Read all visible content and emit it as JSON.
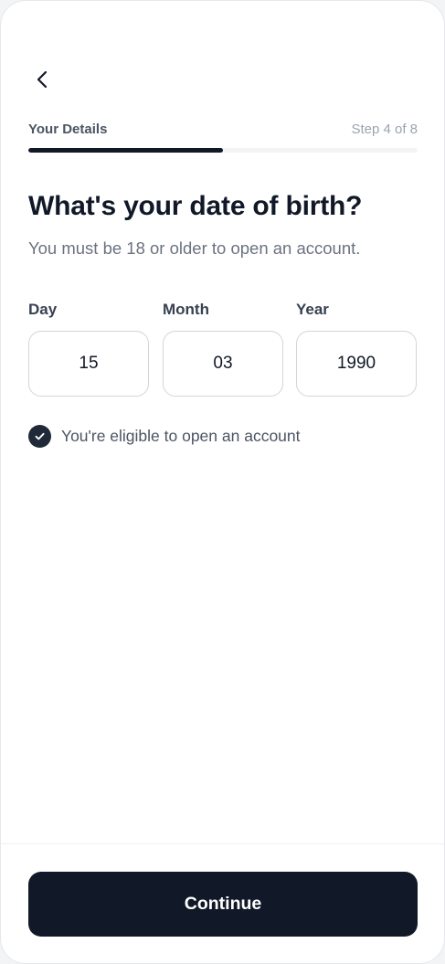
{
  "header": {
    "back_icon": "chevron-left-icon",
    "section_label": "Your Details",
    "step_label": "Step 4 of 8",
    "progress_fraction": 0.5
  },
  "main": {
    "title": "What's your date of birth?",
    "subtitle": "You must be 18 or older to open an account."
  },
  "dob": {
    "day": {
      "label": "Day",
      "value": "15"
    },
    "month": {
      "label": "Month",
      "value": "03"
    },
    "year": {
      "label": "Year",
      "value": "1990"
    }
  },
  "eligibility": {
    "icon": "check-circle-icon",
    "text": "You're eligible to open an account"
  },
  "footer": {
    "continue_label": "Continue"
  },
  "colors": {
    "primary": "#111827",
    "muted_text": "#6b7280",
    "border": "#d1d5db",
    "track": "#f3f4f6"
  }
}
